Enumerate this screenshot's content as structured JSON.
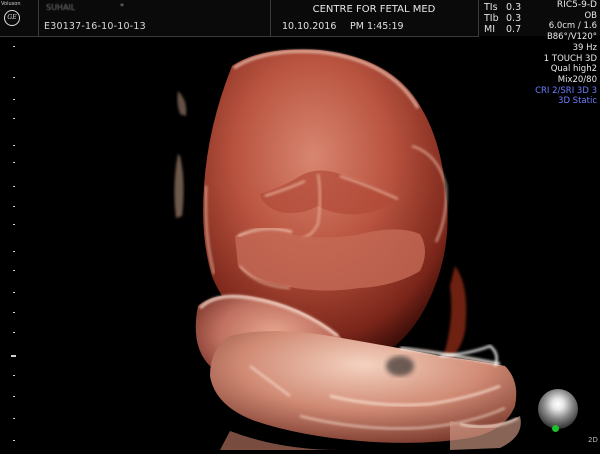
{
  "header": {
    "brand": "Voluson",
    "logo_text": "GE",
    "patient_name": "SUHAIL",
    "patient_flag": "*",
    "patient_id": "E30137-16-10-10-13",
    "institution": "CENTRE FOR FETAL MED",
    "date": "10.10.2016",
    "time": "PM 1:45:19"
  },
  "indices": [
    {
      "label": "TIs",
      "value": "0.3"
    },
    {
      "label": "TIb",
      "value": "0.3"
    },
    {
      "label": "MI",
      "value": "0.7"
    }
  ],
  "settings": {
    "probe": "RIC5-9-D",
    "preset": "OB",
    "depth": "6.0cm / 1.6",
    "angles": "B86°/V120°",
    "frame_rate": "39 Hz",
    "mode": "1 TOUCH 3D",
    "quality": "Qual high2",
    "mix": "Mix20/80",
    "cri_srI": "CRI 2/SRI 3D 3",
    "render_mode": "3D Static"
  },
  "colors": {
    "accent_blue": "#6f7dff",
    "flesh_highlight": "#f2c2a8",
    "flesh_mid": "#c8674f",
    "flesh_dark": "#6a1d14",
    "orientation_green": "#1bbf2a"
  },
  "corner_mark": "2D"
}
